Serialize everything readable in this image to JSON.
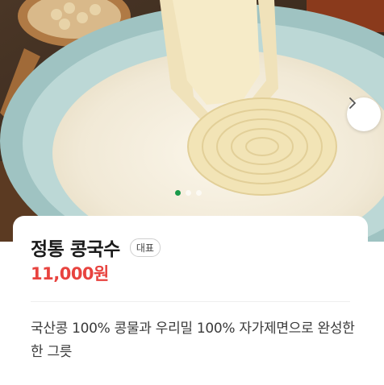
{
  "hero": {
    "image": "bowl-of-kongguksu-noodles",
    "next_icon": "chevron-right-icon",
    "dots": [
      {
        "active": true
      },
      {
        "active": false
      },
      {
        "active": false
      }
    ],
    "dot_active_color": "#1a9a4a"
  },
  "product": {
    "name": "정통 콩국수",
    "badge": "대표",
    "price": "11,000원",
    "description": "국산콩 100% 콩물과 우리밀 100% 자가제면으로 완성한 한 그릇",
    "price_color": "#e8433f"
  }
}
